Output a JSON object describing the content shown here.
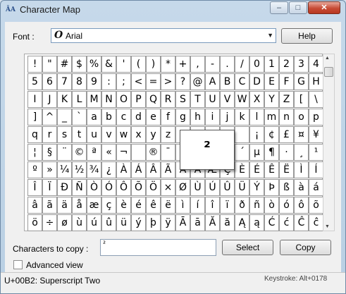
{
  "window": {
    "title": "Character Map",
    "minimize": "–",
    "maximize": "□",
    "close": "✕"
  },
  "font": {
    "label": "Font :",
    "value": "Arial",
    "icon": "O"
  },
  "help_label": "Help",
  "grid": {
    "selected_char": "²",
    "rows": [
      [
        "!",
        "\"",
        "#",
        "$",
        "%",
        "&",
        "'",
        "(",
        ")",
        "*",
        "+",
        ",",
        "-",
        ".",
        "/",
        "0",
        "1",
        "2",
        "3",
        "4"
      ],
      [
        "5",
        "6",
        "7",
        "8",
        "9",
        ":",
        ";",
        "<",
        "=",
        ">",
        "?",
        "@",
        "A",
        "B",
        "C",
        "D",
        "E",
        "F",
        "G",
        "H"
      ],
      [
        "I",
        "J",
        "K",
        "L",
        "M",
        "N",
        "O",
        "P",
        "Q",
        "R",
        "S",
        "T",
        "U",
        "V",
        "W",
        "X",
        "Y",
        "Z",
        "[",
        "\\"
      ],
      [
        "]",
        "^",
        "_",
        "`",
        "a",
        "b",
        "c",
        "d",
        "e",
        "f",
        "g",
        "h",
        "i",
        "j",
        "k",
        "l",
        "m",
        "n",
        "o",
        "p"
      ],
      [
        "q",
        "r",
        "s",
        "t",
        "u",
        "v",
        "w",
        "x",
        "y",
        "z",
        "{",
        "|",
        "}",
        "~",
        "",
        "¡",
        "¢",
        "£",
        "¤",
        "¥"
      ],
      [
        "¦",
        "§",
        "¨",
        "©",
        "ª",
        "«",
        "¬",
        "",
        "®",
        "¯",
        "°",
        "±",
        "²",
        "³",
        "´",
        "µ",
        "¶",
        "·",
        "¸",
        "¹"
      ],
      [
        "º",
        "»",
        "¼",
        "½",
        "¾",
        "¿",
        "À",
        "Á",
        "Â",
        "Ã",
        "Ä",
        "Å",
        "Æ",
        "Ç",
        "È",
        "É",
        "Ê",
        "Ë",
        "Ì",
        "Í"
      ],
      [
        "Î",
        "Ï",
        "Ð",
        "Ñ",
        "Ò",
        "Ó",
        "Ô",
        "Õ",
        "Ö",
        "×",
        "Ø",
        "Ù",
        "Ú",
        "Û",
        "Ü",
        "Ý",
        "Þ",
        "ß",
        "à",
        "á"
      ],
      [
        "â",
        "ã",
        "ä",
        "å",
        "æ",
        "ç",
        "è",
        "é",
        "ê",
        "ë",
        "ì",
        "í",
        "î",
        "ï",
        "ð",
        "ñ",
        "ò",
        "ó",
        "ô",
        "õ"
      ],
      [
        "ö",
        "÷",
        "ø",
        "ù",
        "ú",
        "û",
        "ü",
        "ý",
        "þ",
        "ÿ",
        "Ā",
        "ā",
        "Ă",
        "ă",
        "Ą",
        "ą",
        "Ć",
        "ć",
        "Ĉ",
        "ĉ"
      ]
    ]
  },
  "copy": {
    "label": "Characters to copy :",
    "value": "²",
    "select_label": "Select",
    "copy_label": "Copy"
  },
  "advanced_view_label": "Advanced view",
  "status": {
    "text": "U+00B2: Superscript Two",
    "keystroke": "Keystroke: Alt+0178"
  }
}
